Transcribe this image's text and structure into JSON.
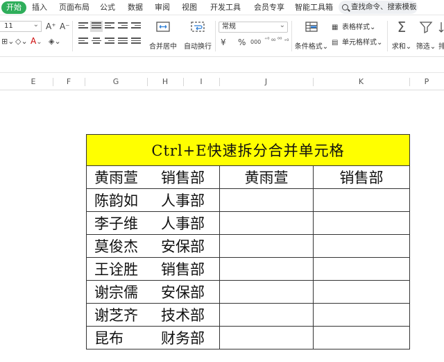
{
  "menu": {
    "items": [
      "开始",
      "插入",
      "页面布局",
      "公式",
      "数据",
      "审阅",
      "视图",
      "开发工具",
      "会员专享",
      "智能工具箱"
    ],
    "search": "查找命令、搜索模板"
  },
  "ribbon": {
    "font_size": "11",
    "grow_font": "A⁺",
    "shrink_font": "A⁻",
    "merge_center": "合并居中",
    "wrap_text": "自动换行",
    "number_format": "常规",
    "currency_symbol": "¥",
    "percent_symbol": "%",
    "thousands_symbol": "000",
    "increase_decimal": "⁺⁰ ₀₀",
    "decrease_decimal": "⁰⁰ ₊₀",
    "conditional_format": "条件格式",
    "table_style": "表格样式",
    "cell_style": "单元格样式",
    "sum": "求和",
    "filter": "筛选",
    "sort_cut": "排"
  },
  "columns": [
    "E",
    "F",
    "G",
    "H",
    "I",
    "J",
    "K",
    "P"
  ],
  "table": {
    "title": "Ctrl+E快速拆分合并单元格",
    "header": {
      "combined": [
        "黄雨萱",
        "销售部"
      ],
      "name": "黄雨萱",
      "dept": "销售部"
    },
    "rows": [
      {
        "name": "陈韵如",
        "dept": "人事部"
      },
      {
        "name": "李子维",
        "dept": "人事部"
      },
      {
        "name": "莫俊杰",
        "dept": "安保部"
      },
      {
        "name": "王诠胜",
        "dept": "销售部"
      },
      {
        "name": "谢宗儒",
        "dept": "安保部"
      },
      {
        "name": "谢芝齐",
        "dept": "技术部"
      },
      {
        "name": "昆布",
        "dept": "财务部"
      }
    ]
  },
  "colors": {
    "accent": "#2fae5b",
    "title_fill": "#ffff00",
    "border": "#333333"
  }
}
